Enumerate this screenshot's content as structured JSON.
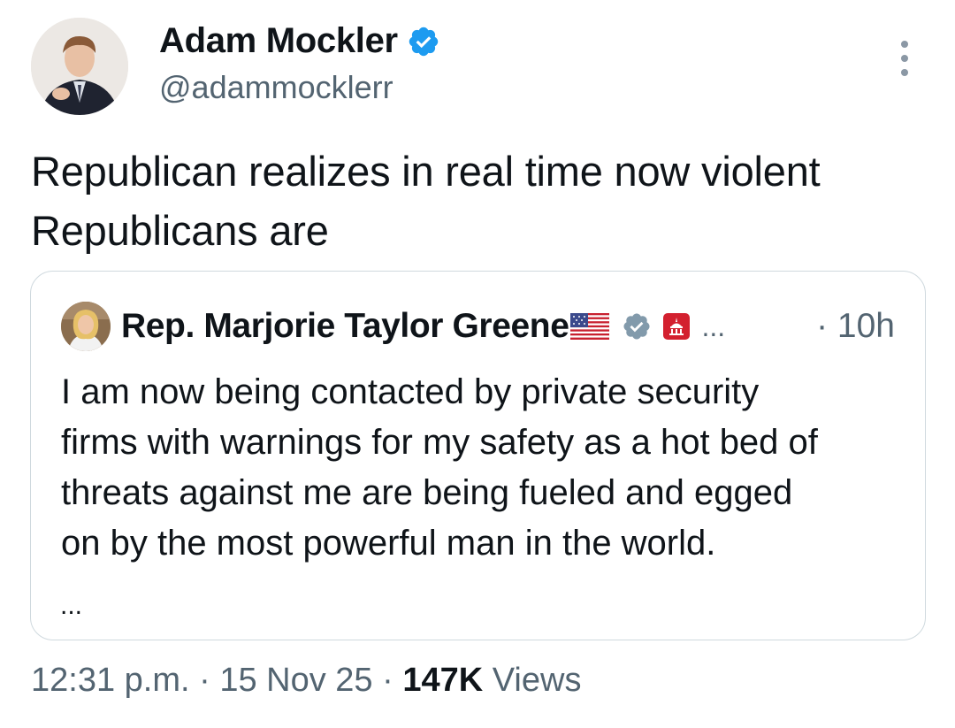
{
  "author": {
    "name": "Adam Mockler",
    "handle": "@adammocklerr"
  },
  "tweet": {
    "text": "Republican realizes in real time now violent\nRepublicans are"
  },
  "quote": {
    "name": "Rep. Marjorie Taylor Greene",
    "ellipsis": "...",
    "time": "· 10h",
    "body": "I am now being contacted by private security\nfirms with warnings for my safety as a hot bed of\nthreats against me are being fueled and egged\non by the most powerful man in the world.",
    "more": "..."
  },
  "meta": {
    "time": "12:31 p.m.",
    "sep1": " · ",
    "date": "15 Nov 25",
    "sep2": " · ",
    "views_count": "147K",
    "views_label": " Views"
  },
  "colors": {
    "verified_blue": "#1d9bf0",
    "verified_gray": "#829aab",
    "secondary_text": "#536471",
    "border": "#cfd9de"
  },
  "icons": [
    "verified-badge-icon",
    "more-options-icon",
    "us-flag-icon",
    "gray-verified-badge-icon",
    "us-house-icon"
  ]
}
